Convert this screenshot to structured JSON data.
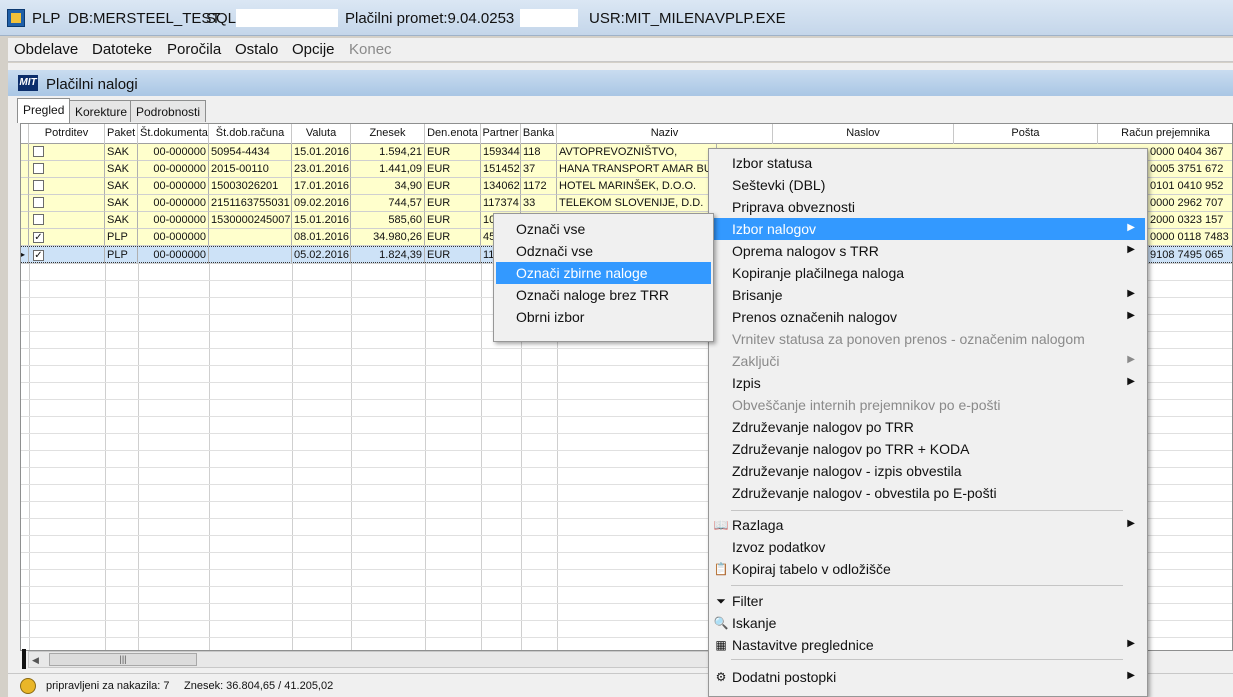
{
  "titlebar": {
    "app": "PLP",
    "db": "DB:MERSTEEL_TEST",
    "sql": "SQL:",
    "promet": "Plačilni promet:9.04.0253",
    "user": "USR:MIT_MILENA",
    "exe": "VPLP.EXE"
  },
  "menubar": [
    "Obdelave",
    "Datoteke",
    "Poročila",
    "Ostalo",
    "Opcije",
    "Konec"
  ],
  "window": {
    "logo": "MIT",
    "title": "Plačilni nalogi"
  },
  "tabs": [
    "Pregled",
    "Korekture",
    "Podrobnosti"
  ],
  "grid": {
    "columns": [
      "Potrditev",
      "Paket",
      "Št.dokumenta",
      "Št.dob.računa",
      "Valuta",
      "Znesek",
      "Den.enota",
      "Partner",
      "Banka",
      "Naziv",
      "Naslov",
      "Pošta",
      "Račun prejemnika"
    ],
    "rows": [
      {
        "paket": "SAK",
        "dok": "00-000000",
        "dob": "50954-4434",
        "valuta": "15.01.2016",
        "znesek": "1.594,21",
        "den": "EUR",
        "partner": "159344",
        "banka": "118",
        "naziv": "AVTOPREVOZNIŠTVO,",
        "racun": "0000 0404 367"
      },
      {
        "paket": "SAK",
        "dok": "00-000000",
        "dob": "2015-00110",
        "valuta": "23.01.2016",
        "znesek": "1.441,09",
        "den": "EUR",
        "partner": "151452",
        "banka": "37",
        "naziv": "HANA TRANSPORT AMAR BU",
        "racun": "0005 3751 672"
      },
      {
        "paket": "SAK",
        "dok": "00-000000",
        "dob": "15003026201",
        "valuta": "17.01.2016",
        "znesek": "34,90",
        "den": "EUR",
        "partner": "134062",
        "banka": "1172",
        "naziv": "HOTEL MARINŠEK, D.O.O.",
        "racun": "0101 0410 952"
      },
      {
        "paket": "SAK",
        "dok": "00-000000",
        "dob": "2151163755031",
        "valuta": "09.02.2016",
        "znesek": "744,57",
        "den": "EUR",
        "partner": "117374",
        "banka": "33",
        "naziv": "TELEKOM SLOVENIJE, D.D.",
        "racun": "0000 2962 707"
      },
      {
        "paket": "SAK",
        "dok": "00-000000",
        "dob": "1530000245007",
        "valuta": "15.01.2016",
        "znesek": "585,60",
        "den": "EUR",
        "partner": "10",
        "banka": "",
        "naziv": "",
        "racun": "2000 0323 157"
      },
      {
        "paket": "PLP",
        "dok": "00-000000",
        "dob": "",
        "valuta": "08.01.2016",
        "znesek": "34.980,26",
        "den": "EUR",
        "partner": "45",
        "banka": "",
        "naziv": "",
        "racun": "0000 0118 7483"
      },
      {
        "paket": "PLP",
        "dok": "00-000000",
        "dob": "",
        "valuta": "05.02.2016",
        "znesek": "1.824,39",
        "den": "EUR",
        "partner": "11",
        "banka": "",
        "naziv": "",
        "racun": "9108 7495 065"
      }
    ]
  },
  "context_menu": {
    "items": [
      {
        "label": "Izbor statusa"
      },
      {
        "label": "Seštevki (DBL)"
      },
      {
        "label": "Priprava obveznosti"
      },
      {
        "label": "Izbor nalogov",
        "highlighted": true,
        "submenu": true
      },
      {
        "label": "Oprema nalogov s TRR",
        "submenu": true
      },
      {
        "label": "Kopiranje plačilnega naloga"
      },
      {
        "label": "Brisanje",
        "submenu": true
      },
      {
        "label": "Prenos označenih nalogov",
        "submenu": true
      },
      {
        "label": "Vrnitev statusa za ponoven prenos - označenim nalogom",
        "disabled": true
      },
      {
        "label": "Zaključi",
        "disabled": true,
        "submenu": true
      },
      {
        "label": "Izpis",
        "submenu": true
      },
      {
        "label": "Obveščanje internih prejemnikov po e-pošti",
        "disabled": true
      },
      {
        "label": "Združevanje nalogov po TRR"
      },
      {
        "label": "Združevanje nalogov po TRR + KODA"
      },
      {
        "label": "Združevanje nalogov - izpis obvestila"
      },
      {
        "label": "Združevanje nalogov - obvestila po E-pošti"
      },
      {
        "label": "Razlaga",
        "submenu": true,
        "icon": "help-book-icon"
      },
      {
        "label": "Izvoz podatkov"
      },
      {
        "label": "Kopiraj tabelo v odložišče",
        "icon": "clipboard-icon"
      },
      {
        "label": "Filter",
        "icon": "filter-icon"
      },
      {
        "label": "Iskanje",
        "icon": "magnifier-icon"
      },
      {
        "label": "Nastavitve preglednice",
        "submenu": true,
        "icon": "grid-settings-icon"
      },
      {
        "label": "Dodatni postopki",
        "submenu": true,
        "icon": "gears-icon"
      }
    ]
  },
  "submenu": {
    "items": [
      {
        "label": "Označi vse"
      },
      {
        "label": "Odznači vse"
      },
      {
        "label": "Označi zbirne naloge",
        "highlighted": true
      },
      {
        "label": "Označi naloge brez TRR"
      },
      {
        "label": "Obrni izbor"
      }
    ]
  },
  "status": {
    "pripravljeni": "pripravljeni za nakazila: 7",
    "znesek": "Znesek: 36.804,65  /  41.205,02"
  },
  "colors": {
    "highlight": "#3399ff",
    "row_yellow": "#ffffcc",
    "row_selected": "#cde2f7"
  }
}
